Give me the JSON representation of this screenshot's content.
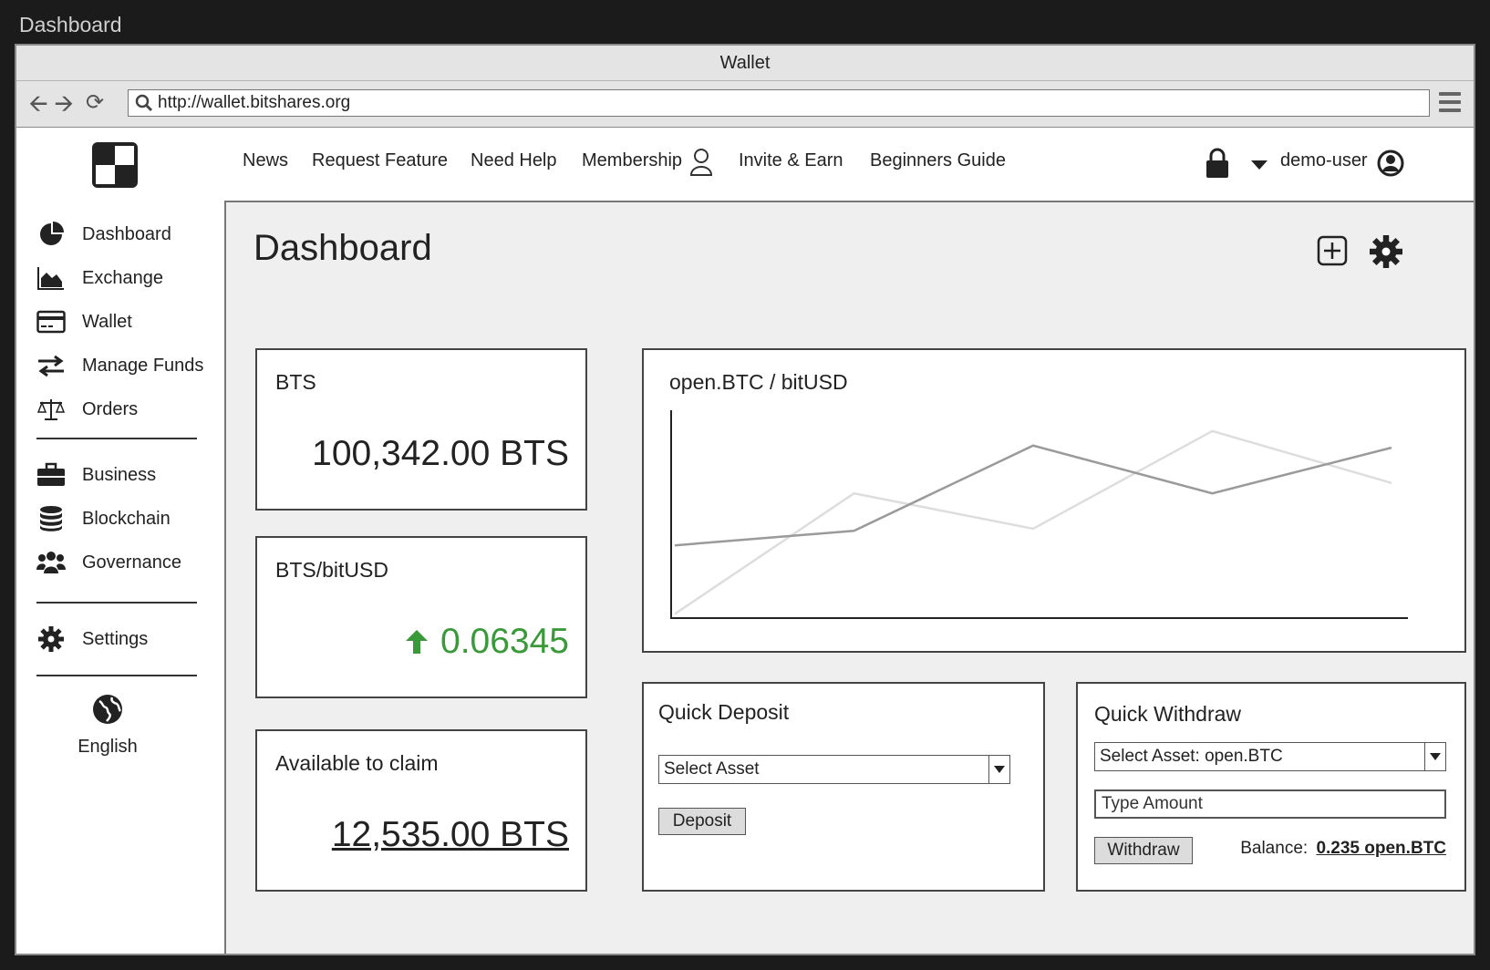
{
  "frame": {
    "title": "Dashboard"
  },
  "browser": {
    "window_title": "Wallet",
    "url": "http://wallet.bitshares.org"
  },
  "sidebar": {
    "items": [
      {
        "label": "Dashboard",
        "icon": "pie-chart-icon"
      },
      {
        "label": "Exchange",
        "icon": "area-chart-icon"
      },
      {
        "label": "Wallet",
        "icon": "credit-card-icon"
      },
      {
        "label": "Manage Funds",
        "icon": "transfer-arrows-icon"
      },
      {
        "label": "Orders",
        "icon": "balance-scale-icon"
      },
      {
        "label": "Business",
        "icon": "briefcase-icon"
      },
      {
        "label": "Blockchain",
        "icon": "database-icon"
      },
      {
        "label": "Governance",
        "icon": "users-icon"
      },
      {
        "label": "Settings",
        "icon": "gear-icon"
      }
    ],
    "language": "English"
  },
  "topnav": {
    "links": [
      "News",
      "Request Feature",
      "Need Help",
      "Membership",
      "Invite & Earn",
      "Beginners Guide"
    ],
    "user": "demo-user"
  },
  "main": {
    "title": "Dashboard",
    "cards": {
      "bts": {
        "caption": "BTS",
        "value": "100,342.00 BTS"
      },
      "rate": {
        "caption": "BTS/bitUSD",
        "value": "0.06345",
        "trend": "up",
        "color": "#3a9a3a"
      },
      "claim": {
        "caption": "Available to claim",
        "value": "12,535.00 BTS"
      }
    },
    "chart_panel": {
      "title": "open.BTC / bitUSD"
    },
    "quick_deposit": {
      "title": "Quick Deposit",
      "select_value": "Select Asset",
      "button": "Deposit"
    },
    "quick_withdraw": {
      "title": "Quick Withdraw",
      "select_value": "Select Asset: open.BTC",
      "amount_placeholder": "Type Amount",
      "button": "Withdraw",
      "balance_label": "Balance:",
      "balance_value": "0.235 open.BTC"
    }
  },
  "chart_data": {
    "type": "line",
    "title": "open.BTC / bitUSD",
    "x": [
      0,
      1,
      2,
      3,
      4
    ],
    "series": [
      {
        "values": [
          3.5,
          4.2,
          8.3,
          6.0,
          8.2
        ],
        "color": "#9a9a9a"
      },
      {
        "values": [
          0.2,
          6.0,
          4.3,
          9.0,
          6.5
        ],
        "color": "#dddddd"
      }
    ],
    "ylim": [
      0,
      10
    ],
    "grid": false
  }
}
